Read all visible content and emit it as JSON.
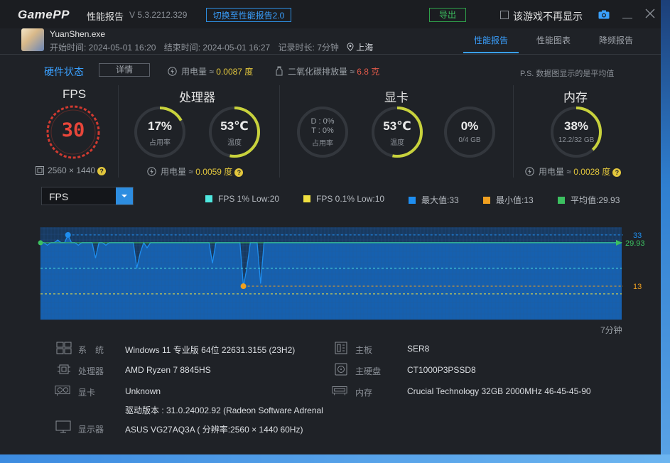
{
  "app": {
    "logo": "GamePP",
    "name": "性能报告",
    "version": "V 5.3.2212.329",
    "switch_label": "切换至性能报告2.0",
    "export_label": "导出",
    "hide_checkbox_label": "该游戏不再显示"
  },
  "session": {
    "game": "YuanShen.exe",
    "start": "开始时间: 2024-05-01 16:20",
    "end": "结束时间: 2024-05-01 16:27",
    "duration": "记录时长: 7分钟",
    "location": "上海"
  },
  "tabs": [
    "性能报告",
    "性能图表",
    "降频报告"
  ],
  "hardware": {
    "title": "硬件状态",
    "detail_label": "详情",
    "power_total_label": "用电量 ≈",
    "power_total": "0.0087 度",
    "co2_label": "二氧化碳排放量 ≈",
    "co2": "6.8 克",
    "ps_note": "P.S. 数据图显示的是平均值"
  },
  "fps_section": {
    "title": "FPS",
    "value": "30",
    "resolution": "2560 × 1440"
  },
  "cpu": {
    "title": "处理器",
    "usage": "17%",
    "usage_label": "占用率",
    "usage_pct": 17,
    "temp": "53℃",
    "temp_label": "温度",
    "temp_pct": 53,
    "power_label": "用电量 ≈",
    "power": "0.0059 度"
  },
  "gpu": {
    "title": "显卡",
    "usage_d": "D : 0%",
    "usage_t": "T : 0%",
    "usage_label": "占用率",
    "temp": "53℃",
    "temp_label": "温度",
    "temp_pct": 53,
    "vram": "0%",
    "vram_sub": "0/4 GB",
    "vram_pct": 0
  },
  "memory": {
    "title": "内存",
    "usage": "38%",
    "usage_sub": "12.2/32 GB",
    "usage_pct": 38,
    "power_label": "用电量 ≈",
    "power": "0.0028 度"
  },
  "chart_controls": {
    "metric": "FPS",
    "legend": [
      {
        "label": "FPS 1% Low:20",
        "color": "#4fe8e0"
      },
      {
        "label": "FPS 0.1% Low:10",
        "color": "#f0e040"
      },
      {
        "label": "最大值:33",
        "color": "#1e8ef0"
      },
      {
        "label": "最小值:13",
        "color": "#f0a020"
      },
      {
        "label": "平均值:29.93",
        "color": "#3cc060"
      }
    ],
    "time_label": "7分钟"
  },
  "chart_data": {
    "type": "area",
    "title": "",
    "series": [
      {
        "values": [
          30,
          30,
          29,
          30,
          30,
          31,
          30,
          30,
          33,
          30,
          30,
          29,
          30,
          30,
          30,
          30,
          24,
          30,
          30,
          29,
          30,
          30,
          30,
          30,
          30,
          30,
          30,
          30,
          20,
          26,
          30,
          28,
          30,
          30,
          30,
          30,
          30,
          30,
          30,
          30,
          30,
          30,
          30,
          30,
          30,
          30,
          30,
          30,
          30,
          30,
          22,
          30,
          30,
          30,
          30,
          30,
          30,
          30,
          30,
          13,
          20,
          30,
          30,
          30,
          14,
          30,
          30,
          30,
          30,
          30,
          30,
          30,
          30,
          30,
          30,
          30,
          30,
          30,
          30,
          30,
          30,
          30,
          30,
          30,
          30,
          30,
          30,
          30,
          30,
          30,
          30,
          30,
          30,
          30,
          30,
          30,
          30,
          30,
          30,
          30,
          30,
          30,
          30,
          30,
          30,
          30,
          30,
          30,
          30,
          30,
          30,
          30,
          30,
          30,
          30,
          30,
          30,
          30,
          30,
          30,
          30,
          30,
          30,
          30,
          30,
          30,
          30,
          30,
          30,
          30,
          30,
          30,
          30,
          30,
          30,
          30,
          30,
          30,
          30,
          30,
          30,
          30,
          30,
          30,
          30,
          30,
          30,
          30,
          30,
          30,
          30,
          30,
          30,
          30,
          30,
          30,
          30,
          30,
          30,
          30,
          30,
          30,
          30,
          30,
          30,
          30,
          30,
          30,
          30,
          30
        ]
      }
    ],
    "ylim": [
      0,
      36
    ],
    "max": 33,
    "min": 13,
    "avg": 29.93,
    "low1": 20,
    "low01": 10,
    "ref_labels": {
      "max": "33",
      "avg": "29.93",
      "min": "13"
    },
    "grid": true,
    "colors": {
      "fill": "#1665b8",
      "line": "#1e8ef0",
      "max": "#1e8ef0",
      "min": "#f0a020",
      "avg": "#3cc060",
      "low1": "#4fe8e0",
      "low01": "#f0e040"
    }
  },
  "system_info": {
    "os_label": "系　统",
    "os": "Windows 11 专业版 64位 22631.3155 (23H2)",
    "cpu_label": "处理器",
    "cpu": "AMD Ryzen 7 8845HS",
    "gpu_label": "显卡",
    "gpu": "Unknown",
    "driver": "驱动版本 : 31.0.24002.92 (Radeon Software Adrenal",
    "monitor_label": "显示器",
    "monitor": "ASUS VG27AQ3A ( 分辨率:2560 × 1440 60Hz)",
    "board_label": "主板",
    "board": "SER8",
    "disk_label": "主硬盘",
    "disk": "CT1000P3PSSD8",
    "mem_label": "内存",
    "mem": "Crucial Technology 32GB 2000MHz 46-45-45-90"
  },
  "icons": {
    "location": "location-pin-icon",
    "power": "power-icon",
    "co2": "leaf-icon",
    "resolution": "screen-icon",
    "camera": "camera-icon"
  }
}
